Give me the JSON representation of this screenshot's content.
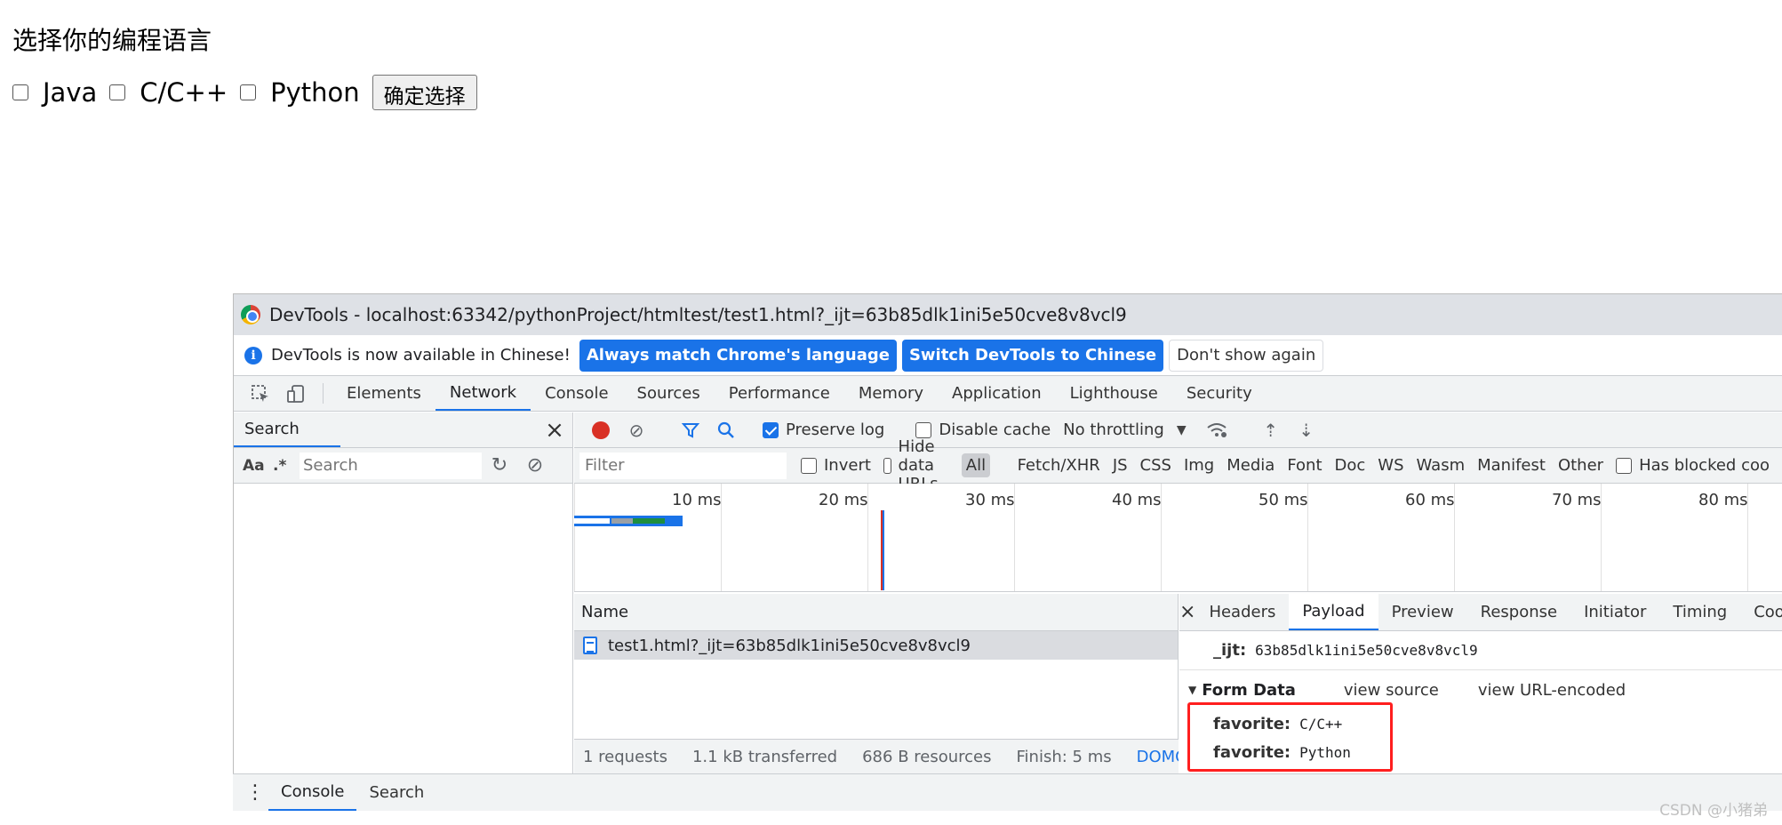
{
  "page": {
    "heading": "选择你的编程语言",
    "options": [
      {
        "label": "Java",
        "checked": false
      },
      {
        "label": "C/C++",
        "checked": false
      },
      {
        "label": "Python",
        "checked": false
      }
    ],
    "submit_label": "确定选择"
  },
  "devtools": {
    "title": "DevTools - localhost:63342/pythonProject/htmltest/test1.html?_ijt=63b85dlk1ini5e50cve8v8vcl9",
    "infobar": {
      "message": "DevTools is now available in Chinese!",
      "btn_match": "Always match Chrome's language",
      "btn_switch": "Switch DevTools to Chinese",
      "btn_dismiss": "Don't show again"
    },
    "tabs": [
      "Elements",
      "Network",
      "Console",
      "Sources",
      "Performance",
      "Memory",
      "Application",
      "Lighthouse",
      "Security"
    ],
    "active_tab": "Network",
    "search_pane": {
      "title": "Search",
      "aa": "Aa",
      "regex": ".*",
      "placeholder": "Search"
    },
    "toolbar": {
      "preserve_log": "Preserve log",
      "disable_cache": "Disable cache",
      "throttling": "No throttling"
    },
    "filter": {
      "placeholder": "Filter",
      "invert": "Invert",
      "hide_data_urls": "Hide data URLs",
      "types": [
        "All",
        "Fetch/XHR",
        "JS",
        "CSS",
        "Img",
        "Media",
        "Font",
        "Doc",
        "WS",
        "Wasm",
        "Manifest",
        "Other"
      ],
      "has_blocked": "Has blocked coo"
    },
    "timeline_ticks": [
      "10 ms",
      "20 ms",
      "30 ms",
      "40 ms",
      "50 ms",
      "60 ms",
      "70 ms",
      "80 ms"
    ],
    "requests": {
      "header": "Name",
      "rows": [
        "test1.html?_ijt=63b85dlk1ini5e50cve8v8vcl9"
      ]
    },
    "status": {
      "requests": "1 requests",
      "transferred": "1.1 kB transferred",
      "resources": "686 B resources",
      "finish": "Finish: 5 ms",
      "domcontent": "DOMContentl"
    },
    "details": {
      "tabs": [
        "Headers",
        "Payload",
        "Preview",
        "Response",
        "Initiator",
        "Timing",
        "Cookies"
      ],
      "active_tab": "Payload",
      "query_key": "_ijt:",
      "query_value": "63b85dlk1ini5e50cve8v8vcl9",
      "form_data_title": "Form Data",
      "view_source": "view source",
      "view_url_encoded": "view URL-encoded",
      "form_items": [
        {
          "key": "favorite:",
          "value": "C/C++"
        },
        {
          "key": "favorite:",
          "value": "Python"
        }
      ]
    },
    "drawer_tabs": [
      "Console",
      "Search"
    ]
  },
  "watermark": "CSDN @小猪弟"
}
